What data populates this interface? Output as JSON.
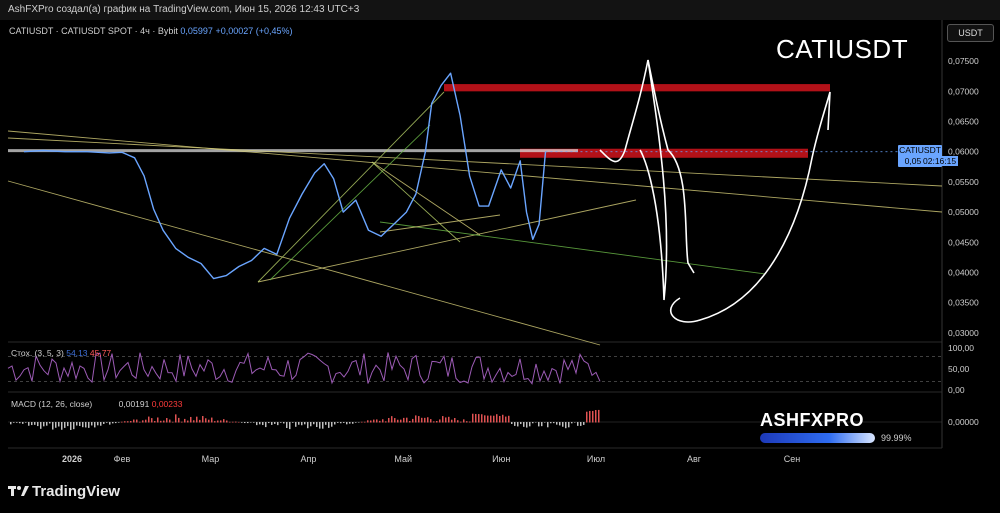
{
  "header": {
    "caption": "AshFXPro создал(а) график на TradingView.com, Июн 15, 2026 12:43 UTC+3"
  },
  "legend": {
    "symbol": "CATIUSDT · CATIUSDT SPOT · 4ч · Bybit",
    "price": "0,05997",
    "change": "+0,00027 (+0,45%)"
  },
  "overlay_title": "CATIUSDT",
  "currency_button": "USDT",
  "price_tag": {
    "symbol": "CATIUSDT",
    "price": "0,05997",
    "countdown": "02:16:15"
  },
  "stoch": {
    "label": "Стох. (3, 5, 3)",
    "k_value": "54,13",
    "d_value": "45,77"
  },
  "macd": {
    "label": "MACD (12, 26, close)",
    "macd_value": "0,00191",
    "signal_value": "0,00233"
  },
  "watermark": {
    "brand": "ASHFXPRO",
    "percent": "99.99%"
  },
  "footer": {
    "logo_text": "TradingView"
  },
  "colors": {
    "price_line": "#6aa5ff",
    "resistance_zone": "#d1141c",
    "stoch_line": "#9c5bb5",
    "drawing": "#ffffff"
  },
  "chart_data": [
    {
      "type": "line",
      "title": "CATIUSDT",
      "x": [
        "2026",
        "Фев",
        "Мар",
        "Апр",
        "Май",
        "Июн",
        "Июл",
        "Авг",
        "Сен"
      ],
      "x_ticks": [
        "2026",
        "Фев",
        "Мар",
        "Апр",
        "Май",
        "Июн",
        "Июл",
        "Авг",
        "Сен"
      ],
      "y_ticks": [
        "0,07500",
        "0,07000",
        "0,06500",
        "0,06000",
        "0,05500",
        "0,05000",
        "0,04500",
        "0,04000",
        "0,03500",
        "0,03000"
      ],
      "ylim": [
        0.0285,
        0.0785
      ],
      "series": [
        {
          "name": "CATIUSDT",
          "points": [
            [
              "2026-01-01",
              0.06
            ],
            [
              "2026-01-07",
              0.0602
            ],
            [
              "2026-01-14",
              0.06
            ],
            [
              "2026-01-21",
              0.06
            ],
            [
              "2026-01-28",
              0.0598
            ],
            [
              "2026-02-01",
              0.0599
            ],
            [
              "2026-02-05",
              0.059
            ],
            [
              "2026-02-08",
              0.056
            ],
            [
              "2026-02-11",
              0.0505
            ],
            [
              "2026-02-14",
              0.047
            ],
            [
              "2026-02-18",
              0.044
            ],
            [
              "2026-02-22",
              0.0425
            ],
            [
              "2026-02-26",
              0.0415
            ],
            [
              "2026-03-02",
              0.039
            ],
            [
              "2026-03-06",
              0.0395
            ],
            [
              "2026-03-10",
              0.041
            ],
            [
              "2026-03-14",
              0.042
            ],
            [
              "2026-03-18",
              0.044
            ],
            [
              "2026-03-22",
              0.043
            ],
            [
              "2026-03-26",
              0.049
            ],
            [
              "2026-03-30",
              0.053
            ],
            [
              "2026-04-03",
              0.0565
            ],
            [
              "2026-04-06",
              0.058
            ],
            [
              "2026-04-09",
              0.0555
            ],
            [
              "2026-04-12",
              0.05
            ],
            [
              "2026-04-16",
              0.052
            ],
            [
              "2026-04-20",
              0.047
            ],
            [
              "2026-04-24",
              0.046
            ],
            [
              "2026-04-28",
              0.048
            ],
            [
              "2026-05-02",
              0.05
            ],
            [
              "2026-05-05",
              0.053
            ],
            [
              "2026-05-08",
              0.06
            ],
            [
              "2026-05-10",
              0.068
            ],
            [
              "2026-05-13",
              0.071
            ],
            [
              "2026-05-16",
              0.073
            ],
            [
              "2026-05-19",
              0.066
            ],
            [
              "2026-05-22",
              0.056
            ],
            [
              "2026-05-25",
              0.051
            ],
            [
              "2026-05-28",
              0.051
            ],
            [
              "2026-06-01",
              0.057
            ],
            [
              "2026-06-04",
              0.054
            ],
            [
              "2026-06-07",
              0.0585
            ],
            [
              "2026-06-09",
              0.05
            ],
            [
              "2026-06-11",
              0.0455
            ],
            [
              "2026-06-13",
              0.048
            ],
            [
              "2026-06-15",
              0.06
            ]
          ]
        }
      ],
      "zones": [
        {
          "name": "resistance-upper",
          "from": 0.07,
          "to": 0.0712
        },
        {
          "name": "resistance-lower",
          "from": 0.059,
          "to": 0.0605
        }
      ]
    },
    {
      "type": "line",
      "title": "Стох. (3, 5, 3)",
      "y_ticks": [
        "100,00",
        "50,00",
        "0,00"
      ],
      "ylim": [
        0,
        100
      ],
      "series": [
        {
          "name": "%K",
          "last": 54.13
        },
        {
          "name": "%D",
          "last": 45.77
        }
      ]
    },
    {
      "type": "bar",
      "title": "MACD (12, 26, close)",
      "y_ticks": [
        "0,00000"
      ],
      "series": [
        {
          "name": "MACD",
          "last": 0.00191
        },
        {
          "name": "Signal",
          "last": 0.00233
        }
      ]
    }
  ]
}
